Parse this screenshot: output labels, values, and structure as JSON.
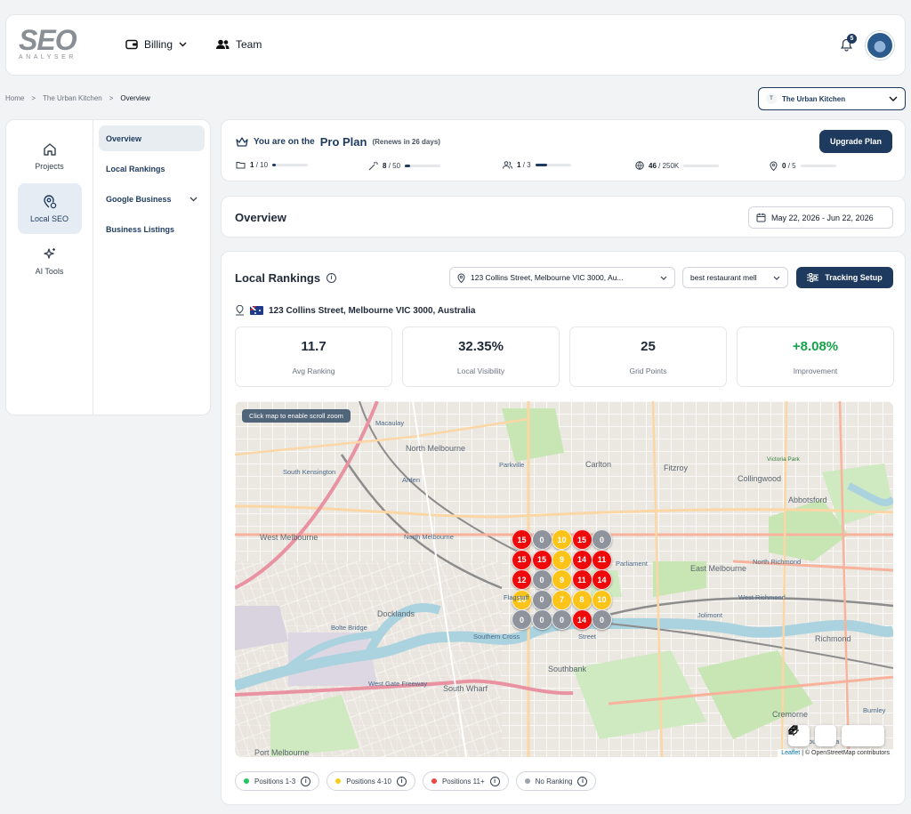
{
  "header": {
    "logo_text": "SEO",
    "logo_sub": "ANALYSER",
    "nav": [
      {
        "label": "Billing"
      },
      {
        "label": "Team"
      }
    ],
    "notification_count": "5"
  },
  "breadcrumb": [
    "Home",
    ">",
    "The Urban Kitchen",
    ">",
    "Overview"
  ],
  "project_selector": {
    "initial": "T",
    "name": "The Urban Kitchen"
  },
  "sidebar": {
    "rail": [
      {
        "label": "Projects"
      },
      {
        "label": "Local SEO"
      },
      {
        "label": "AI Tools"
      }
    ],
    "subnav": [
      {
        "label": "Overview"
      },
      {
        "label": "Local Rankings"
      },
      {
        "label": "Google Business"
      },
      {
        "label": "Business Listings"
      }
    ]
  },
  "plan": {
    "prefix": "You are on the",
    "name": "Pro Plan",
    "renew": "(Renews in 26 days)",
    "upgrade_label": "Upgrade Plan",
    "usage": [
      {
        "used": "1",
        "limit": "/ 10",
        "fraction": 0.1
      },
      {
        "used": "8",
        "limit": "/ 50",
        "fraction": 0.16
      },
      {
        "used": "1",
        "limit": "/ 3",
        "fraction": 0.33
      },
      {
        "used": "46",
        "limit": "/ 250K",
        "fraction": 0.0
      },
      {
        "used": "0",
        "limit": "/ 5",
        "fraction": 0.0
      }
    ]
  },
  "overview": {
    "title": "Overview",
    "date_range": "May 22, 2026 - Jun 22, 2026"
  },
  "rankings": {
    "title": "Local Rankings",
    "address_select": "123 Collins Street, Melbourne VIC 3000, Au...",
    "keyword_select": "best restaurant mell",
    "tracking_label": "Tracking Setup",
    "location": "123 Collins Street, Melbourne VIC 3000, Australia",
    "stats": [
      {
        "value": "11.7",
        "label": "Avg Ranking"
      },
      {
        "value": "32.35%",
        "label": "Local Visibility"
      },
      {
        "value": "25",
        "label": "Grid Points"
      },
      {
        "value": "+8.08%",
        "label": "Improvement"
      }
    ],
    "grid": [
      [
        15,
        0,
        10,
        15,
        0
      ],
      [
        15,
        15,
        9,
        14,
        11
      ],
      [
        12,
        0,
        9,
        11,
        14
      ],
      [
        10,
        0,
        7,
        8,
        10
      ],
      [
        0,
        0,
        0,
        14,
        0
      ]
    ],
    "map": {
      "scroll_hint": "Click map to enable scroll zoom",
      "attribution_leaflet": "Leaflet",
      "attribution_rest": "| © OpenStreetMap contributors",
      "labels": [
        "North Melbourne",
        "Parkville",
        "Carlton",
        "Fitzroy",
        "Collingwood",
        "Abbotsford",
        "West Melbourne",
        "North Melbourne",
        "East Melbourne",
        "Docklands",
        "Southbank",
        "South Wharf",
        "Richmond",
        "Port Melbourne",
        "Cremorne",
        "Burnley",
        "Macaulay",
        "Arden",
        "South Kensington",
        "Bolte Bridge",
        "West Gate Freeway",
        "Victoria Park",
        "Jolimont",
        "Parliament",
        "Southern Cross",
        "North Richmond",
        "West Richmond",
        "Flagstaff",
        "Street",
        "South Yarra"
      ]
    },
    "legend": [
      {
        "label": "Positions 1-3",
        "color": "#22c55e"
      },
      {
        "label": "Positions 4-10",
        "color": "#facc15"
      },
      {
        "label": "Positions 11+",
        "color": "#ef4444"
      },
      {
        "label": "No Ranking",
        "color": "#9ca3af"
      }
    ]
  },
  "colors": {
    "brand": "#1e3a5f",
    "rank_top": "#22c55e",
    "rank_mid": "#fcc419",
    "rank_low": "#ee0a0a",
    "rank_none": "#8e939c"
  }
}
